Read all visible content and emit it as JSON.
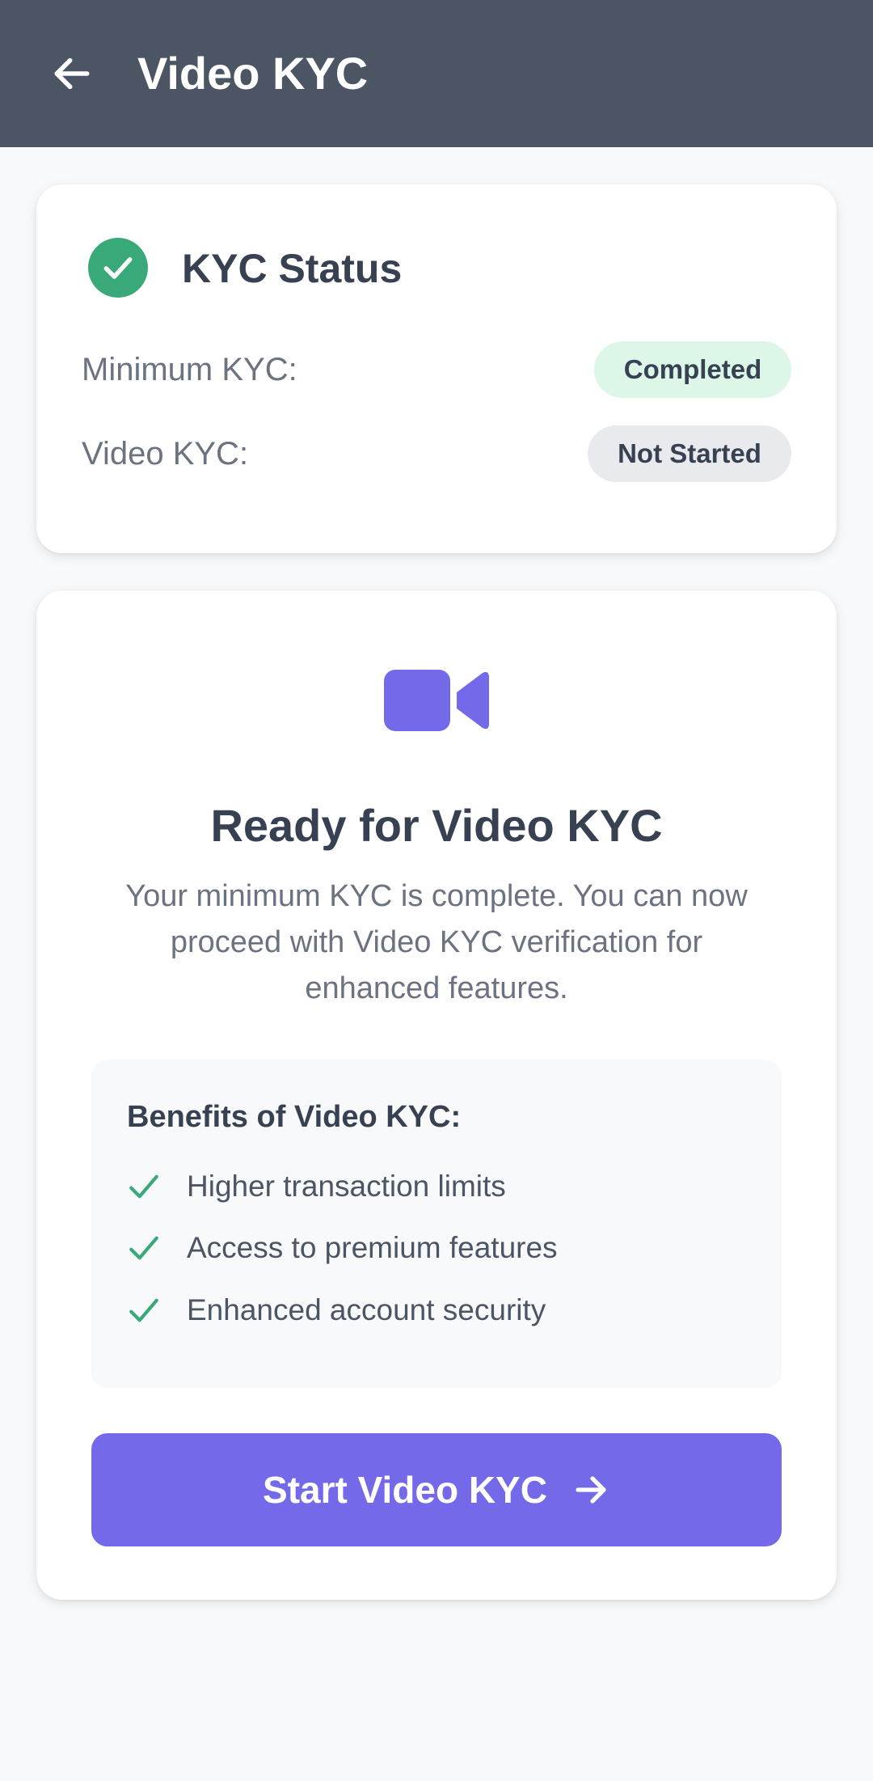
{
  "app_bar": {
    "title": "Video KYC",
    "back_icon": "arrow-left-icon",
    "background": "#4b5563"
  },
  "status_card": {
    "icon": "check-circle-icon",
    "title": "KYC Status",
    "rows": [
      {
        "label": "Minimum KYC:",
        "status": "Completed",
        "status_color": "#dcf7e8"
      },
      {
        "label": "Video KYC:",
        "status": "Not Started",
        "status_color": "#e9eaed"
      }
    ]
  },
  "action_card": {
    "icon": "video-camera-icon",
    "icon_color": "#7469e8",
    "title": "Ready for Video KYC",
    "description": "Your minimum KYC is complete. You can now proceed with Video KYC verification for enhanced features.",
    "benefits": {
      "title": "Benefits of Video KYC:",
      "items": [
        "Higher transaction limits",
        "Access to premium features",
        "Enhanced account security"
      ],
      "check_color": "#3aa97a"
    },
    "button": {
      "label": "Start Video KYC",
      "icon": "arrow-right-icon",
      "color": "#7469e8"
    }
  }
}
